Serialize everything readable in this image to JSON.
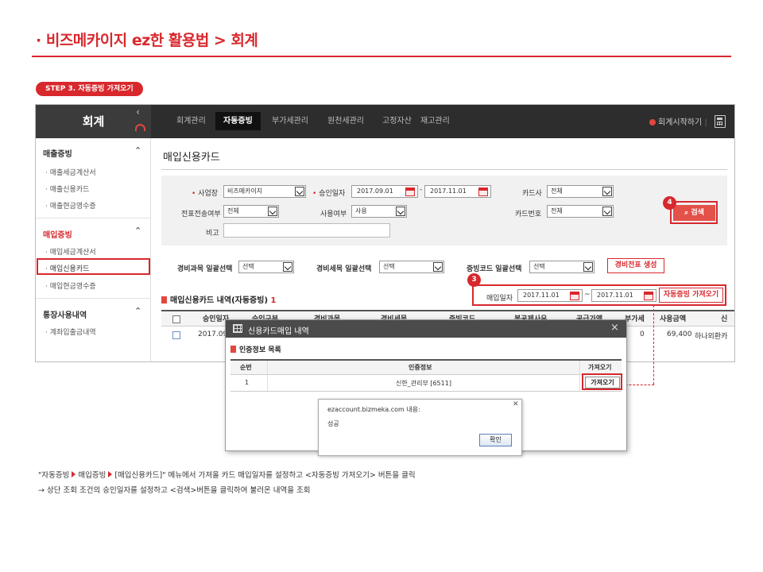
{
  "header": {
    "title": "· 비즈메카이지 ez한 활용법 > 회계",
    "step_badge": "STEP 3.  자동증빙 가져오기"
  },
  "app": {
    "brand": "회계",
    "nav": [
      "회계관리",
      "자동증빙",
      "부가세관리",
      "원천세관리",
      "고정자산",
      "재고관리"
    ],
    "nav_active": "자동증빙",
    "start_link": "회계시작하기",
    "sidebar": {
      "groups": [
        {
          "label": "매출증빙",
          "items": [
            "· 매출세금계산서",
            "· 매출신용카드",
            "· 매출현금영수증"
          ]
        },
        {
          "label": "매입증빙",
          "items": [
            "· 매입세금계산서",
            "· 매입신용카드",
            "· 매입현금영수증"
          ]
        },
        {
          "label": "통장사용내역",
          "items": [
            "· 계좌입출금내역"
          ]
        }
      ],
      "active_item": "· 매입신용카드"
    },
    "main": {
      "title": "매입신용카드",
      "filters": {
        "business_label": "사업장",
        "business_value": "비즈메카이지",
        "approval_date_label": "승인일자",
        "approval_from": "2017.09.01",
        "approval_to": "2017.11.01",
        "date_sep": "-",
        "card_company_label": "카드사",
        "card_company_value": "전체",
        "voucher_sent_label": "전표전송여부",
        "voucher_sent_value": "전체",
        "usage_label": "사용여부",
        "usage_value": "사용",
        "card_number_label": "카드번호",
        "card_number_value": "전체",
        "memo_label": "비고",
        "memo_value": "",
        "search_button": "검색"
      },
      "bulk": {
        "expense_account_label": "경비과목 일괄선택",
        "expense_account_value": "선택",
        "expense_detail_label": "경비세목 일괄선택",
        "expense_detail_value": "선택",
        "evidence_code_label": "증빙코드 일괄선택",
        "evidence_code_value": "선택",
        "create_voucher_button": "경비전표 생성"
      },
      "auto_fetch": {
        "purchase_date_label": "매입일자",
        "from": "2017.11.01",
        "sep": "~",
        "to": "2017.11.01",
        "button": "자동증빙 가져오기"
      },
      "list_title": "매입신용카드 내역(자동증빙)",
      "list_count": "1",
      "grid_headers": [
        "승인일자",
        "승인구분",
        "경비과목",
        "경비세목",
        "증빙코드",
        "봉공제사유",
        "공급가액",
        "부가세",
        "사용금액",
        "신"
      ],
      "grid_row": {
        "approval_date": "2017.09",
        "vat": "0",
        "amount": "69,400",
        "merchant": "하나외환카"
      }
    },
    "callouts": {
      "search": "4",
      "fetch": "3"
    }
  },
  "popup": {
    "title": "신용카드매입 내역",
    "section": "인증정보 목록",
    "headers": [
      "순번",
      "인증정보",
      "가져오기"
    ],
    "row": {
      "no": "1",
      "cert": "신한_관리부 [6511]",
      "button": "가져오기"
    }
  },
  "alert": {
    "message": "ezaccount.bizmeka.com 내용:",
    "body": "성공",
    "ok": "확인"
  },
  "footnotes": {
    "line1_a": "\"자동증빙",
    "line1_b": "매입증빙",
    "line1_c": "[매입신용카드]\" 메뉴에서  가져올 카드 매입일자를 설정하고 <자동증빙 가져오기> 버튼을 클릭",
    "line2": "→ 상단 조회 조건의 승인일자를 설정하고 <검색>버튼을 클릭하여 불러온 내역을 조회"
  },
  "colors": {
    "accent": "#d8282d",
    "topbar": "#2d2d2d",
    "popup_header": "#4b4b4b"
  }
}
